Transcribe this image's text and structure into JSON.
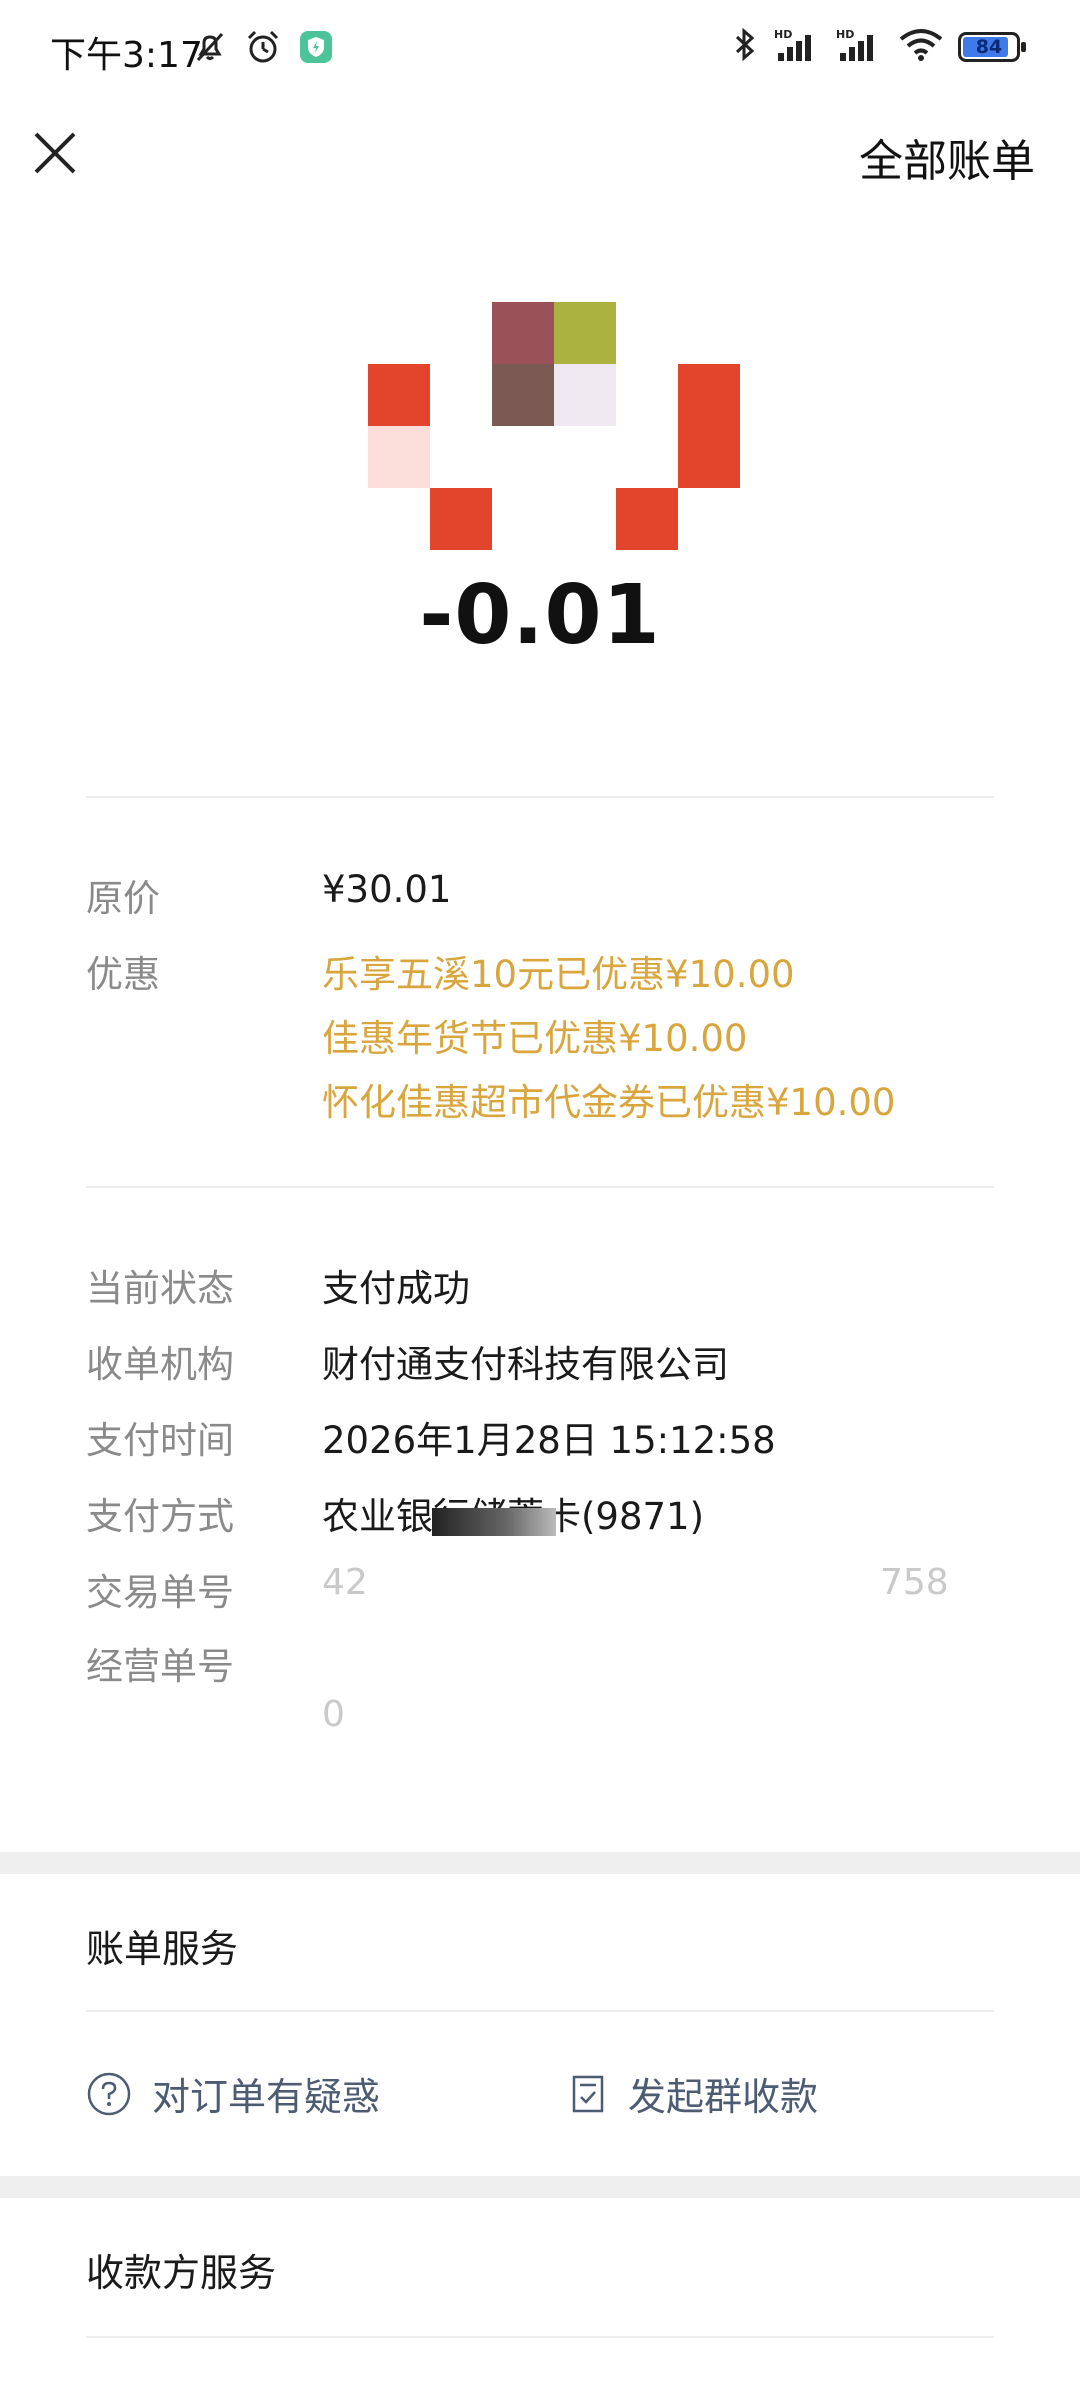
{
  "status_bar": {
    "time": "下午3:17",
    "battery": "84",
    "icons": [
      "mute-bell-icon",
      "alarm-icon",
      "shield-app-icon",
      "bluetooth-icon",
      "hd-signal-icon",
      "wifi-icon",
      "battery-icon"
    ]
  },
  "nav": {
    "close_icon": "close-icon",
    "all_bills_label": "全部账单"
  },
  "logo": {
    "colors": {
      "red": "#e2452b",
      "pink": "#fbddd9",
      "mauve": "#9a5258",
      "olive": "#abb23f",
      "brown": "#7a5a52",
      "lavender": "#efe8f1"
    }
  },
  "amount": "-0.01",
  "price": {
    "label": "原价",
    "value": "¥30.01"
  },
  "discount": {
    "label": "优惠",
    "lines": [
      "乐享五溪10元已优惠¥10.00",
      "佳惠年货节已优惠¥10.00",
      "怀化佳惠超市代金券已优惠¥10.00"
    ]
  },
  "details": {
    "status_label": "当前状态",
    "status_value": "支付成功",
    "institution_label": "收单机构",
    "institution_value": "财付通支付科技有限公司",
    "time_label": "支付时间",
    "time_value": "2026年1月28日 15:12:58",
    "method_label": "支付方式",
    "method_value": "农业银行储蓄卡(9871)",
    "trade_no_label": "交易单号",
    "trade_no_value_start": "42",
    "trade_no_value_end": "758",
    "merchant_no_label": "经营单号",
    "merchant_no_value_start": "0"
  },
  "bill_service": {
    "title": "账单服务",
    "question_label": "对订单有疑惑",
    "group_collect_label": "发起群收款"
  },
  "payee_service": {
    "title": "收款方服务"
  },
  "colors": {
    "discount": "#d9a53d",
    "label": "#8a8a8a",
    "link": "#4d5b73"
  }
}
